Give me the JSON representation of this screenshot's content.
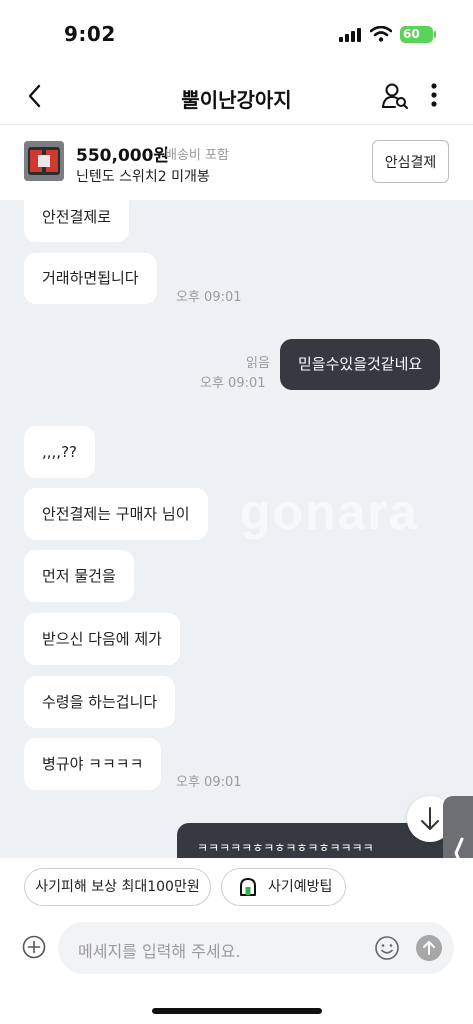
{
  "status_bar": {
    "time": "9:02",
    "battery": "60"
  },
  "header": {
    "title": "뿔이난강아지"
  },
  "product": {
    "price": "550,000원",
    "shipping": "배송비 포함",
    "name": "닌텐도 스위치2 미개봉",
    "pay_button": "안심결제"
  },
  "chat": {
    "watermark": "gonara",
    "messages": [
      {
        "text": "안전결제로",
        "mine": false
      },
      {
        "text": "거래하면됩니다",
        "mine": false,
        "time": "오후 09:01"
      },
      {
        "text": "믿을수있을것같네요",
        "mine": true,
        "read": "읽음",
        "time": "오후 09:01"
      },
      {
        "text": ",,,,??",
        "mine": false
      },
      {
        "text": "안전결제는 구매자 님이",
        "mine": false
      },
      {
        "text": "먼저 물건을",
        "mine": false
      },
      {
        "text": "받으신 다음에 제가",
        "mine": false
      },
      {
        "text": "수령을 하는겁니다",
        "mine": false
      },
      {
        "text": "병규야 ㅋㅋㅋㅋ",
        "mine": false,
        "time": "오후 09:01"
      },
      {
        "text": "ㅋㅋㅋㅋㅋㅎㅋㅎㅋㅎㅋㅎㅋㅋㅋㅋ",
        "mine": true
      }
    ]
  },
  "chips": {
    "compensation": "사기피해 보상 최대100만원",
    "tips": "사기예방팁"
  },
  "composer": {
    "placeholder": "메세지를 입력해 주세요."
  },
  "colors": {
    "my_bubble": "#363a40",
    "chat_bg": "#eef1f4",
    "battery": "#5bd35b"
  }
}
